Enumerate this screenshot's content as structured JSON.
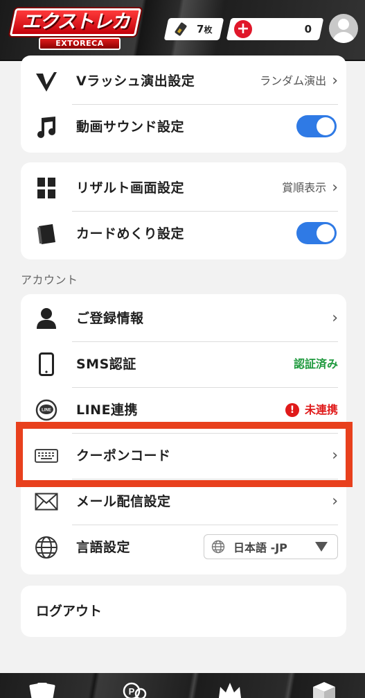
{
  "header": {
    "logo_main": "エクストレカ",
    "logo_sub": "EXTORECA",
    "tickets": {
      "count": "7",
      "unit": "枚"
    },
    "points": "0"
  },
  "settings_group_1": {
    "items": [
      {
        "label": "Vラッシュ演出設定",
        "value": "ランダム演出",
        "chevron": "›",
        "icon": "v-logo-icon"
      },
      {
        "label": "動画サウンド設定",
        "toggle_on": true,
        "icon": "music-note-icon"
      }
    ]
  },
  "settings_group_2": {
    "items": [
      {
        "label": "リザルト画面設定",
        "value": "賞順表示",
        "chevron": "›",
        "icon": "grid-icon"
      },
      {
        "label": "カードめくり設定",
        "toggle_on": true,
        "icon": "cards-icon"
      }
    ]
  },
  "account": {
    "section_title": "アカウント",
    "items": [
      {
        "label": "ご登録情報",
        "chevron": "›",
        "icon": "user-icon"
      },
      {
        "label": "SMS認証",
        "status": "認証済み",
        "icon": "smartphone-icon"
      },
      {
        "label": "LINE連携",
        "status": "未連携",
        "alert": "!",
        "icon": "line-icon",
        "icon_text": "LINE"
      },
      {
        "label": "クーポンコード",
        "chevron": "›",
        "icon": "keyboard-icon"
      },
      {
        "label": "メール配信設定",
        "chevron": "›",
        "icon": "mail-icon"
      },
      {
        "label": "言語設定",
        "select_value": "日本語 -JP",
        "icon": "globe-icon"
      }
    ]
  },
  "logout": {
    "label": "ログアウト"
  },
  "colors": {
    "toggle_on": "#2f7ae5",
    "verified": "#1f9a3e",
    "unlinked": "#e01a1a",
    "highlight": "#e8401d"
  },
  "bottom_nav": {
    "icons": [
      "cards-nav-icon",
      "points-nav-icon",
      "crown-nav-icon",
      "box-nav-icon"
    ]
  }
}
